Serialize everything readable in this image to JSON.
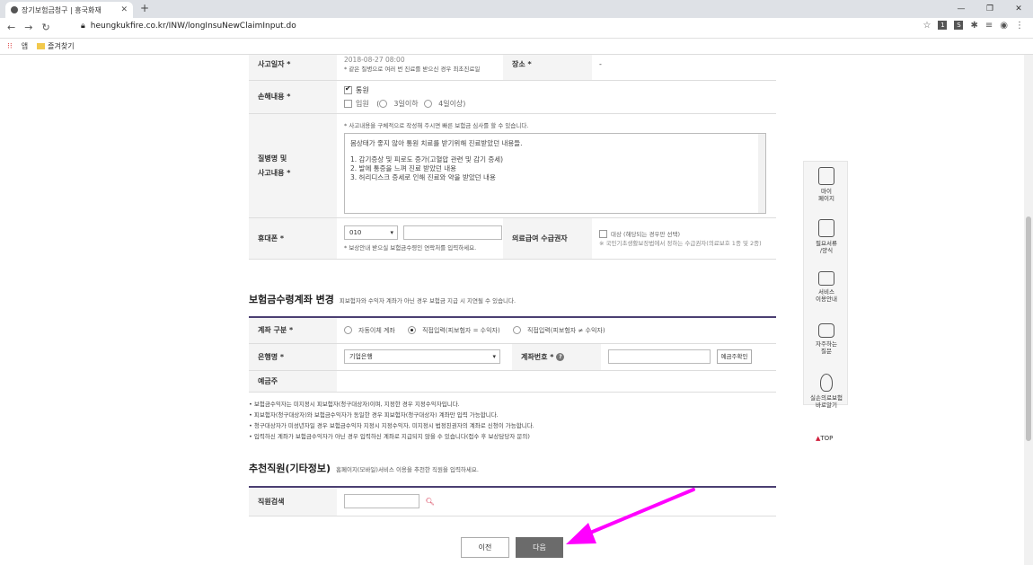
{
  "browser": {
    "tab_title": "장기보험금청구 | 흥국화재",
    "new_tab": "+",
    "url": "heungkukfire.co.kr/INW/longInsuNewClaimInput.do",
    "bookmarks": [
      "앱",
      "즐겨찾기"
    ],
    "window_controls": [
      "—",
      "❐",
      "✕"
    ]
  },
  "form": {
    "accident_date_label": "사고일자 *",
    "accident_date_value": "2018-08-27 08:00",
    "accident_date_note": "* 같은 질병으로 여러 번 진료를 받으신 경우 최초진료일",
    "place_label": "장소 *",
    "place_value": "-",
    "damage_label": "손해내용 *",
    "damage_options": {
      "outpatient": "통원",
      "inpatient": "입원",
      "paren_open": "(",
      "under3": "3일이하",
      "over4": "4일이상",
      "paren_close": ")"
    },
    "disease_label_1": "질병명 및",
    "disease_label_2": "사고내용 *",
    "disease_note": "* 사고내용을 구체적으로 작성해 주시면 빠른 보험금 심사를 할 수 있습니다.",
    "disease_text_lines": [
      "몸상태가 좋지 않아 통원 치료를 받기위해 진료받았던 내용들.",
      "",
      "1. 감기증상 및 피로도 증가(고혈압 관련 및 감기 증세)",
      "2. 발에 통증을 느껴 진료 받았던 내용",
      "3. 허리디스크 증세로 인해 진료와 약을 받았던 내용"
    ],
    "phone_label": "휴대폰 *",
    "phone_prefix": "010",
    "phone_note": "* 보상안내 받으실 보험금수령인 연락처를 입력하세요.",
    "medical_aid_label": "의료급여 수급권자",
    "medical_aid_option": "대상 (해당되는 경우만 선택)",
    "medical_aid_note": "※ 국민기초생활보장법에서 정하는 수급권자(의료보호 1종 및 2종)"
  },
  "account": {
    "title": "보험금수령계좌 변경",
    "subtitle": "피보험자와 수익자 계좌가 아닌 경우 보험금 지급 시 지연될 수 있습니다.",
    "type_label": "계좌 구분 *",
    "type_options": [
      "자동이체 계좌",
      "직접입력(피보험자 = 수익자)",
      "직접입력(피보험자 ≠ 수익자)"
    ],
    "bank_label": "은행명 *",
    "bank_value": "기업은행",
    "acct_no_label": "계좌번호 *",
    "acct_no_help": "?",
    "verify_button": "예금주확인",
    "holder_label": "예금주",
    "notes": [
      "• 보험금수익자는 미지정시 피보험자(청구대상자)이며, 지정한 경우 지정수익자입니다.",
      "• 피보험자(청구대상자)와 보험금수익자가 동일한 경우 피보험자(청구대상자) 계좌만 입력 가능합니다.",
      "• 청구대상자가 미성년자일 경우 보험금수익자 지정시 지정수익자, 미지정시 법정친권자의 계좌로 신청이 가능합니다.",
      "• 입력하신 계좌가 보험금수익자가 아닌 경우 입력하신 계좌로 지급되지 않을 수 있습니다(접수 후 보상담당자 문의)"
    ]
  },
  "referral": {
    "title": "추천직원(기타정보)",
    "subtitle": "홈페이지(모바일)서비스 이용을 추천한 직원을 입력하세요.",
    "search_label": "직원검색"
  },
  "buttons": {
    "prev": "이전",
    "next": "다음"
  },
  "sidebar": {
    "items": [
      {
        "label1": "마이",
        "label2": "페이지",
        "icon": "person-icon"
      },
      {
        "label1": "필요서류",
        "label2": "/양식",
        "icon": "document-icon"
      },
      {
        "label1": "서비스",
        "label2": "이용안내",
        "icon": "monitor-icon"
      },
      {
        "label1": "자주하는",
        "label2": "질문",
        "icon": "chat-icon"
      },
      {
        "label1": "실손의료보험",
        "label2": "바로알기",
        "icon": "bulb-icon"
      }
    ],
    "top": "TOP"
  },
  "colors": {
    "accent_purple": "#4b3f72",
    "next_button": "#6b6b6b",
    "annotation_arrow": "#ff00ff",
    "brand_red": "#d01f3c"
  }
}
